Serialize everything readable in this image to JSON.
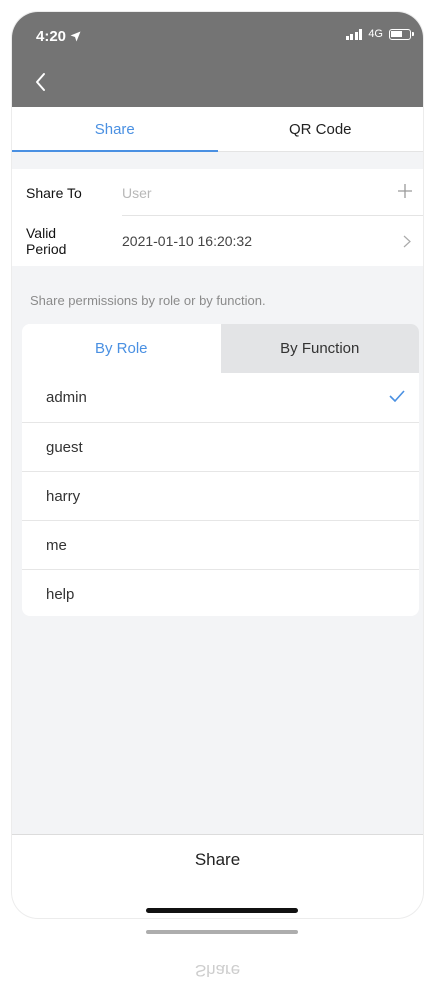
{
  "status_bar": {
    "time": "4:20",
    "network": "4G"
  },
  "tabs": [
    {
      "label": "Share"
    },
    {
      "label": "QR Code"
    }
  ],
  "form": {
    "share_to": {
      "label": "Share To",
      "placeholder": "User"
    },
    "valid_period": {
      "label_line1": "Valid",
      "label_line2": "Period",
      "value": "2021-01-10 16:20:32"
    }
  },
  "hint": "Share permissions by role or by function.",
  "permission_tabs": [
    {
      "label": "By Role"
    },
    {
      "label": "By Function"
    }
  ],
  "roles": [
    {
      "name": "admin",
      "selected": true
    },
    {
      "name": "guest",
      "selected": false
    },
    {
      "name": "harry",
      "selected": false
    },
    {
      "name": "me",
      "selected": false
    },
    {
      "name": "help",
      "selected": false
    }
  ],
  "bottom": {
    "share_label": "Share"
  },
  "reflection_text": "Share",
  "colors": {
    "accent": "#4a90e2",
    "header": "#747474",
    "background": "#f3f4f6"
  }
}
